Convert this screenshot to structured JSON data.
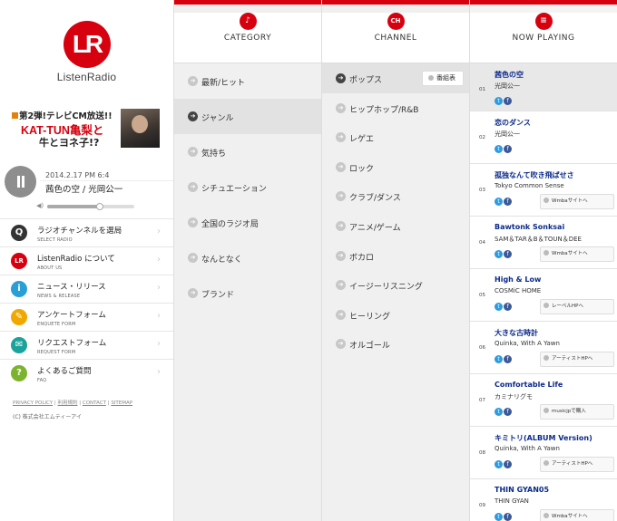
{
  "brand": {
    "logo_text": "LR",
    "wordmark": "ListenRadio"
  },
  "ad": {
    "line1": "第2弾!テレビCM放送!!",
    "line2": "KAT-TUN亀梨と",
    "line3": "牛とヨネ子!?"
  },
  "player": {
    "datetime": "2014.2.17 PM 6:4",
    "track": "茜色の空 / 光岡公一",
    "volume": 0.6
  },
  "menu": [
    {
      "jp": "ラジオチャンネルを選局",
      "en": "SELECT RADIO",
      "icon": "search-icon",
      "color": "#333333",
      "glyph": "Q"
    },
    {
      "jp": "ListenRadio について",
      "en": "ABOUT US",
      "icon": "lr-logo-icon",
      "color": "#d7000f",
      "glyph": "LR"
    },
    {
      "jp": "ニュース・リリース",
      "en": "NEWS & RELEASE",
      "icon": "info-icon",
      "color": "#2a9fd6",
      "glyph": "i"
    },
    {
      "jp": "アンケートフォーム",
      "en": "ENQUETE FORM",
      "icon": "pencil-icon",
      "color": "#f0a800",
      "glyph": "✎"
    },
    {
      "jp": "リクエストフォーム",
      "en": "REQUEST FORM",
      "icon": "chat-icon",
      "color": "#1aa39a",
      "glyph": "✉"
    },
    {
      "jp": "よくあるご質問",
      "en": "FAQ",
      "icon": "question-icon",
      "color": "#7cb32e",
      "glyph": "?"
    }
  ],
  "footer": {
    "links": [
      "PRIVACY POLICY",
      "利用規約",
      "CONTACT",
      "SITEMAP"
    ],
    "copyright": "(C) 株式会社エムティーアイ"
  },
  "category": {
    "title": "CATEGORY",
    "icon": "music-note-icon",
    "glyph": "♪",
    "items": [
      "最新/ヒット",
      "ジャンル",
      "気持ち",
      "シチュエーション",
      "全国のラジオ局",
      "なんとなく",
      "ブランド"
    ],
    "active_index": 1
  },
  "channel": {
    "title": "CHANNEL",
    "icon": "ch-icon",
    "glyph": "CH",
    "items": [
      "ポップス",
      "ヒップホップ/R&B",
      "レゲエ",
      "ロック",
      "クラブ/ダンス",
      "アニメ/ゲーム",
      "ボカロ",
      "イージーリスニング",
      "ヒーリング",
      "オルゴール"
    ],
    "active_index": 0,
    "program_button": "番組表"
  },
  "now_playing": {
    "title": "NOW PLAYING",
    "icon": "list-icon",
    "glyph": "≡",
    "tracks": [
      {
        "num": "01",
        "title": "茜色の空",
        "artist": "光岡公一",
        "buy": ""
      },
      {
        "num": "02",
        "title": "恋のダンス",
        "artist": "光岡公一",
        "buy": ""
      },
      {
        "num": "03",
        "title": "孤独なんて吹き飛ばせさ",
        "artist": "Tokyo Common Sense",
        "buy": "Wmbaサイトへ"
      },
      {
        "num": "04",
        "title": "Bawtonk Sonksai",
        "artist": "SAM＆TAR＆B＆TOUN＆DEE",
        "buy": "Wmbaサイトへ"
      },
      {
        "num": "05",
        "title": "High & Low",
        "artist": "COSMiC HOME",
        "buy": "レーベルHPへ"
      },
      {
        "num": "06",
        "title": "大きな古時計",
        "artist": "Quinka, With A Yawn",
        "buy": "アーティストHPへ"
      },
      {
        "num": "07",
        "title": "Comfortable Life",
        "artist": "カミナリグモ",
        "buy": "musicjpで購入"
      },
      {
        "num": "08",
        "title": "キミトリ(ALBUM Version)",
        "artist": "Quinka, With A Yawn",
        "buy": "アーティストHPへ"
      },
      {
        "num": "09",
        "title": "THIN GYAN05",
        "artist": "THIN GYAN",
        "buy": "Wmbaサイトへ"
      }
    ]
  }
}
